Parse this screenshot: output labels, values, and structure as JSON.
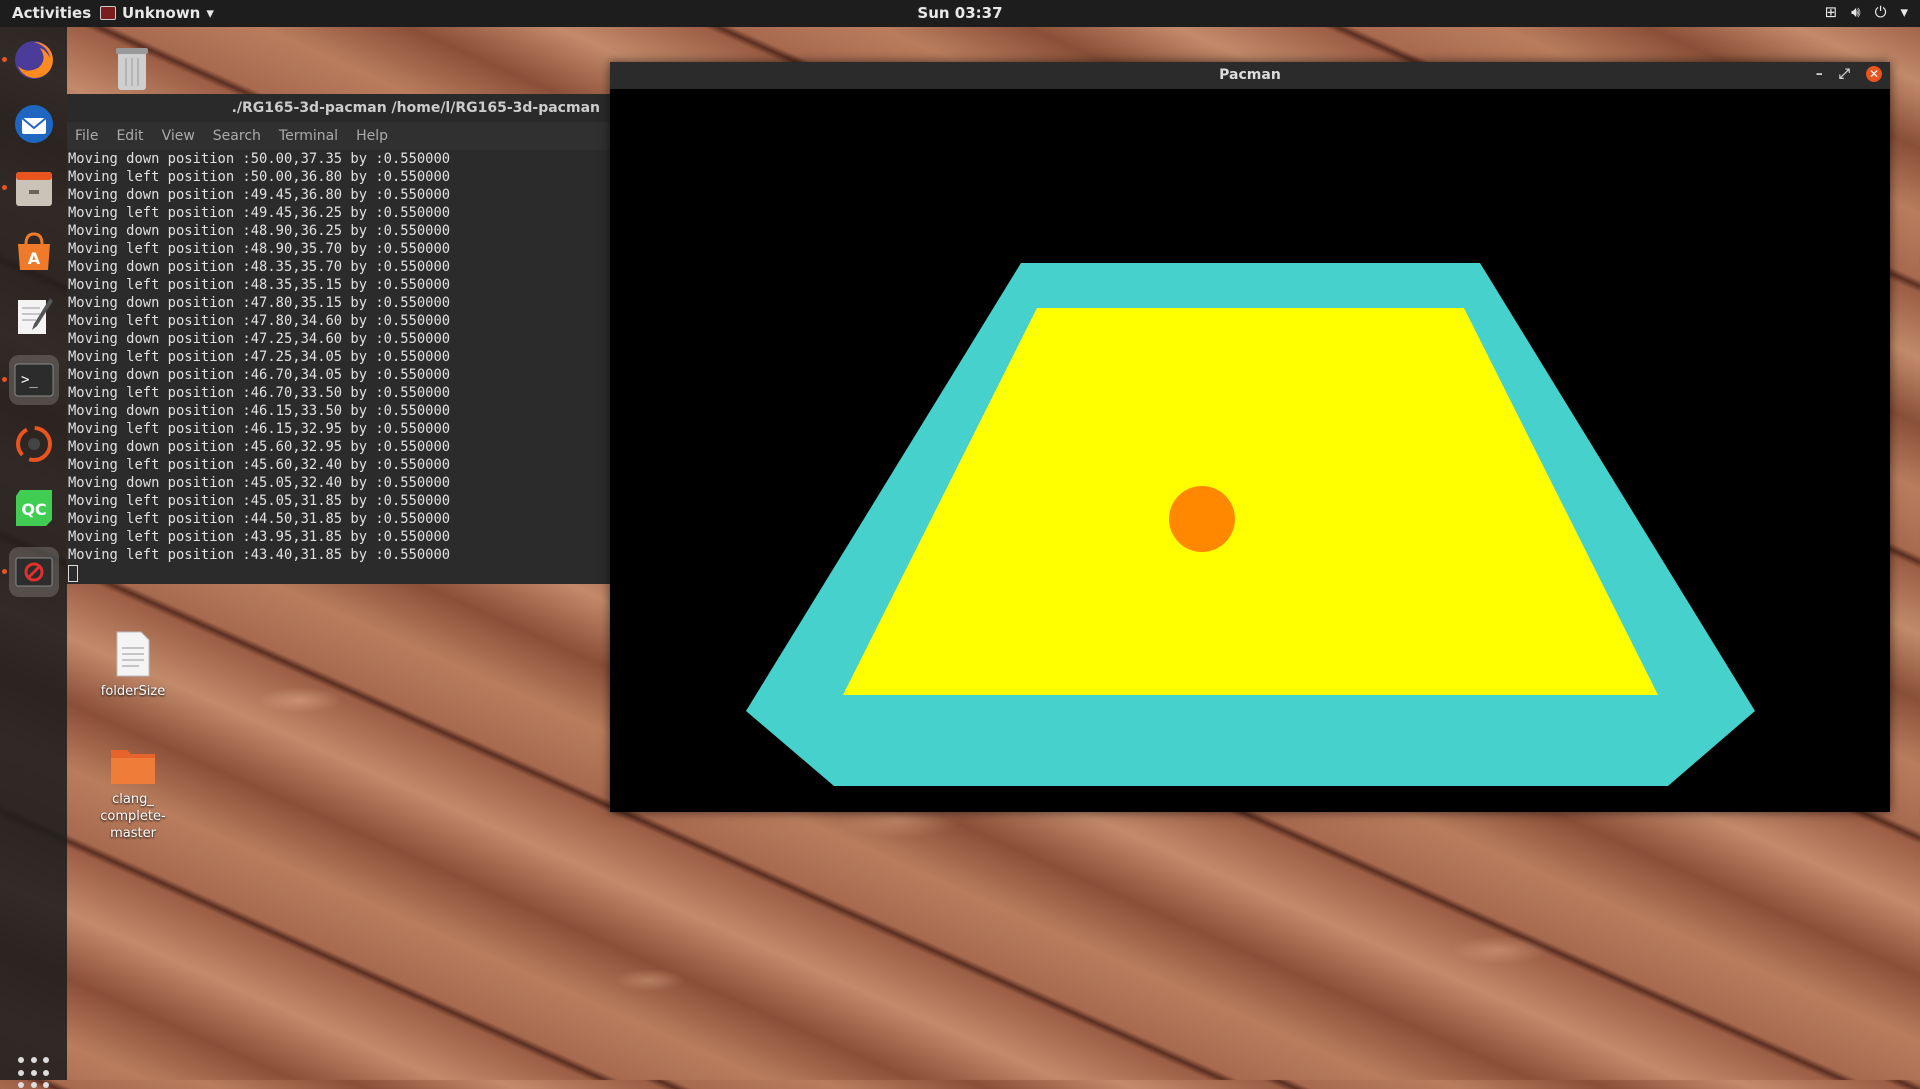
{
  "topbar": {
    "activities": "Activities",
    "app_name": "Unknown",
    "clock": "Sun 03:37",
    "tray_icons": [
      "network-icon",
      "volume-icon",
      "power-icon",
      "chevron-down-icon"
    ]
  },
  "dock": {
    "apps": [
      "firefox-icon",
      "thunderbird-icon",
      "files-icon",
      "software-center-icon",
      "text-editor-icon",
      "terminal-icon",
      "ubuntu-update-icon",
      "qt-creator-icon",
      "pacman-app-icon"
    ],
    "show_apps": "show-applications-icon"
  },
  "desktop": {
    "icons": [
      {
        "label": "folderSize"
      },
      {
        "label": "clang_\ncomplete-\nmaster"
      }
    ]
  },
  "terminal": {
    "title": "./RG165-3d-pacman  /home/l/RG165-3d-pacman",
    "menu": [
      "File",
      "Edit",
      "View",
      "Search",
      "Terminal",
      "Help"
    ],
    "lines": [
      "Moving down position :50.00,37.35 by :0.550000",
      "Moving left position :50.00,36.80 by :0.550000",
      "Moving down position :49.45,36.80 by :0.550000",
      "Moving left position :49.45,36.25 by :0.550000",
      "Moving down position :48.90,36.25 by :0.550000",
      "Moving left position :48.90,35.70 by :0.550000",
      "Moving down position :48.35,35.70 by :0.550000",
      "Moving left position :48.35,35.15 by :0.550000",
      "Moving down position :47.80,35.15 by :0.550000",
      "Moving left position :47.80,34.60 by :0.550000",
      "Moving down position :47.25,34.60 by :0.550000",
      "Moving left position :47.25,34.05 by :0.550000",
      "Moving down position :46.70,34.05 by :0.550000",
      "Moving left position :46.70,33.50 by :0.550000",
      "Moving down position :46.15,33.50 by :0.550000",
      "Moving left position :46.15,32.95 by :0.550000",
      "Moving down position :45.60,32.95 by :0.550000",
      "Moving left position :45.60,32.40 by :0.550000",
      "Moving down position :45.05,32.40 by :0.550000",
      "Moving left position :45.05,31.85 by :0.550000",
      "Moving left position :44.50,31.85 by :0.550000",
      "Moving left position :43.95,31.85 by :0.550000",
      "Moving left position :43.40,31.85 by :0.550000"
    ]
  },
  "pacman_window": {
    "title": "Pacman",
    "colors": {
      "background": "#000000",
      "border": "#47d1cc",
      "floor": "#ffff00",
      "player": "#ff8800"
    }
  }
}
